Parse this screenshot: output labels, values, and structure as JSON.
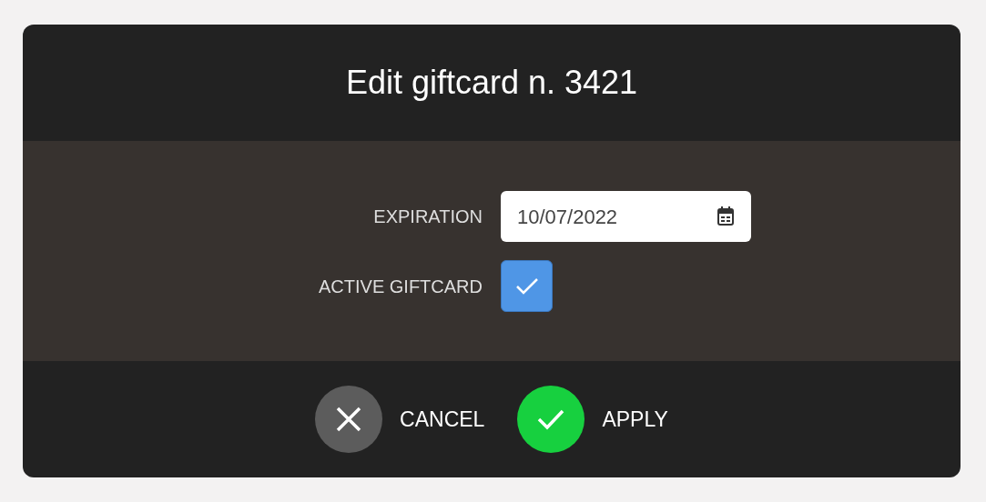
{
  "dialog": {
    "title": "Edit giftcard n. 3421",
    "fields": [
      {
        "kind": "date",
        "label": "EXPIRATION",
        "value": "10/07/2022"
      },
      {
        "kind": "checkbox",
        "label": "ACTIVE GIFTCARD",
        "checked": true
      }
    ],
    "buttons": [
      {
        "kind": "cancel",
        "label": "CANCEL"
      },
      {
        "kind": "apply",
        "label": "APPLY"
      }
    ]
  }
}
